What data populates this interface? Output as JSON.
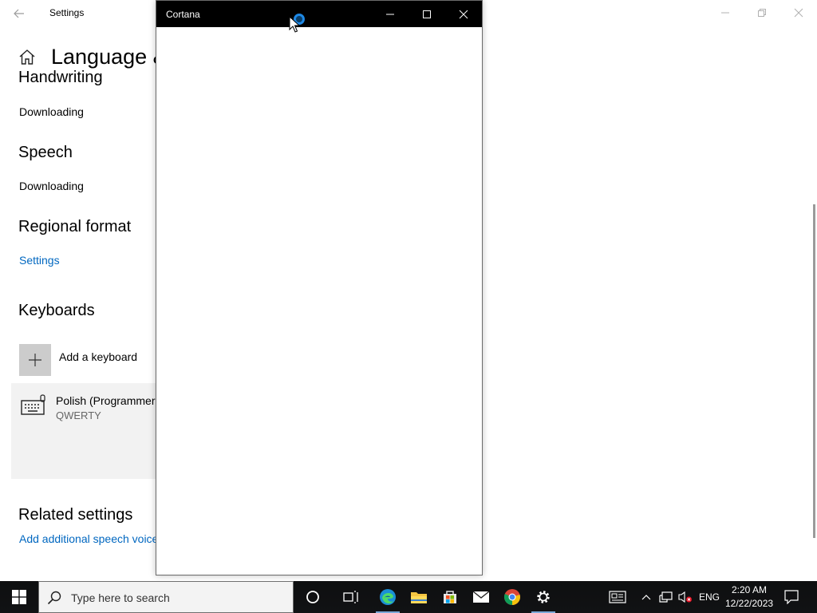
{
  "settings": {
    "title": "Settings",
    "page_title": "Language & region",
    "sections": {
      "handwriting": {
        "heading": "Handwriting",
        "status": "Downloading"
      },
      "speech": {
        "heading": "Speech",
        "status": "Downloading"
      },
      "regional": {
        "heading": "Regional format",
        "link": "Settings"
      },
      "keyboards": {
        "heading": "Keyboards",
        "add_label": "Add a keyboard",
        "items": [
          {
            "name": "Polish (Programmers)",
            "layout": "QWERTY"
          }
        ]
      },
      "related": {
        "heading": "Related settings",
        "link": "Add additional speech voices"
      }
    }
  },
  "cortana": {
    "title": "Cortana"
  },
  "taskbar": {
    "search_placeholder": "Type here to search",
    "language": "ENG",
    "time": "2:20 AM",
    "date": "12/22/2023"
  },
  "colors": {
    "accent": "#0067c0",
    "taskbar": "#101112",
    "cortana_titlebar": "#000000"
  }
}
